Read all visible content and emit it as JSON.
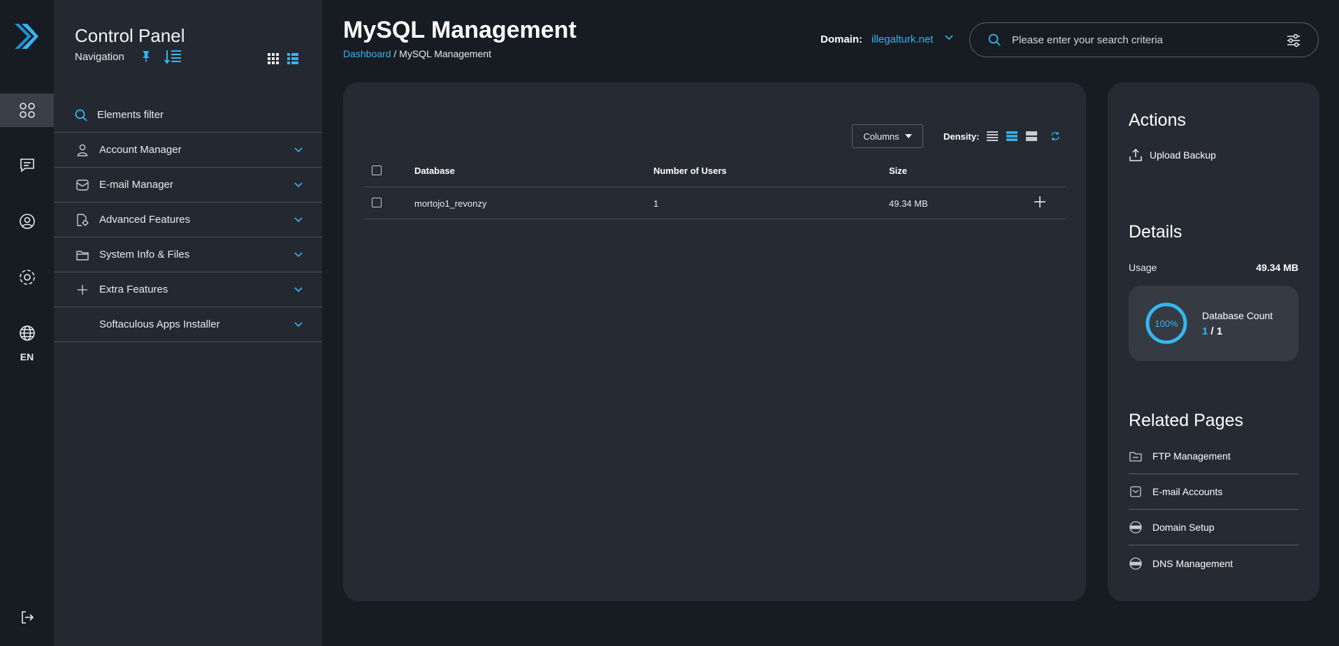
{
  "rail": {
    "items": [
      {
        "icon": "apps-icon"
      },
      {
        "icon": "messages-icon"
      },
      {
        "icon": "user-circle-icon"
      },
      {
        "icon": "settings-icon"
      },
      {
        "icon": "globe-icon"
      }
    ],
    "language": "EN",
    "logout_icon": "logout-icon"
  },
  "sidebar": {
    "title": "Control Panel",
    "subtitle": "Navigation",
    "filter_placeholder": "Elements filter",
    "items": [
      {
        "label": "Account Manager",
        "icon": "user-icon"
      },
      {
        "label": "E-mail Manager",
        "icon": "mail-icon"
      },
      {
        "label": "Advanced Features",
        "icon": "advanced-icon"
      },
      {
        "label": "System Info & Files",
        "icon": "folder-icon"
      },
      {
        "label": "Extra Features",
        "icon": "plus-icon"
      },
      {
        "label": "Softaculous Apps Installer",
        "icon": ""
      }
    ]
  },
  "header": {
    "title": "MySQL Management",
    "breadcrumb": {
      "link": "Dashboard",
      "separator": " / ",
      "current": "MySQL Management"
    },
    "domain_label": "Domain:",
    "domain_value": "illegalturk.net",
    "search_placeholder": "Please enter your search criteria"
  },
  "toolbar": {
    "columns_label": "Columns",
    "density_label": "Density:"
  },
  "table": {
    "headers": [
      "Database",
      "Number of Users",
      "Size"
    ],
    "rows": [
      {
        "database": "mortojo1_revonzy",
        "users": "1",
        "size": "49.34 MB"
      }
    ]
  },
  "side": {
    "actions_title": "Actions",
    "upload_label": "Upload Backup",
    "details_title": "Details",
    "usage_label": "Usage",
    "usage_value": "49.34 MB",
    "db_percent": "100%",
    "db_percent_fraction": 1.0,
    "db_count_label": "Database Count",
    "db_count_current": "1",
    "db_count_sep": " / ",
    "db_count_total": "1",
    "related_title": "Related Pages",
    "related": [
      {
        "label": "FTP Management",
        "icon": "ftp-folder-icon"
      },
      {
        "label": "E-mail Accounts",
        "icon": "mail-accounts-icon"
      },
      {
        "label": "Domain Setup",
        "icon": "www-globe-icon"
      },
      {
        "label": "DNS Management",
        "icon": "dns-globe-icon"
      }
    ]
  },
  "colors": {
    "accent": "#35b6f0",
    "background": "#171b22",
    "panel": "#242831",
    "card": "#262a33"
  }
}
